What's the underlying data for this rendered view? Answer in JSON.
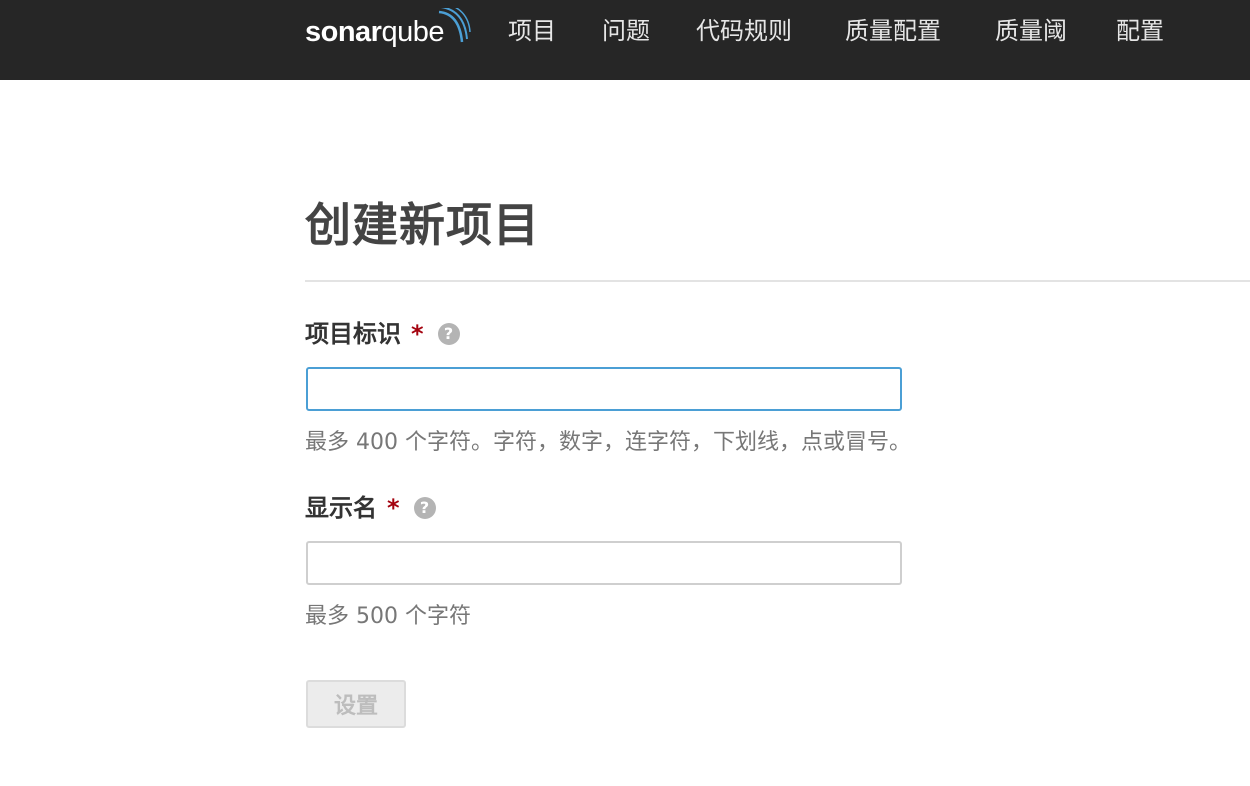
{
  "header": {
    "logo": {
      "text_bold": "sonar",
      "text_regular": "qube",
      "icon": "sonar-waves-icon"
    },
    "nav": [
      {
        "label": "项目"
      },
      {
        "label": "问题"
      },
      {
        "label": "代码规则"
      },
      {
        "label": "质量配置"
      },
      {
        "label": "质量阈"
      },
      {
        "label": "配置"
      }
    ]
  },
  "page": {
    "title": "创建新项目"
  },
  "form": {
    "project_key": {
      "label": "项目标识",
      "required_mark": "*",
      "help_icon": "question-circle-icon",
      "value": "",
      "hint": "最多 400 个字符。字符，数字，连字符，下划线，点或冒号。"
    },
    "display_name": {
      "label": "显示名",
      "required_mark": "*",
      "help_icon": "question-circle-icon",
      "value": "",
      "hint": "最多 500 个字符"
    },
    "submit_label": "设置"
  },
  "colors": {
    "topbar": "#262626",
    "required": "#a4030f",
    "focus_border": "#4b9fd5",
    "logo_waves": "#4b9fd5"
  }
}
